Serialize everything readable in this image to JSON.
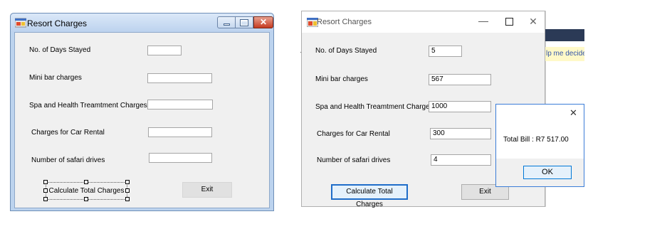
{
  "left_window": {
    "title": "Resort Charges",
    "labels": {
      "days": "No. of Days Stayed",
      "minibar": "Mini bar charges",
      "spa": "Spa and Health Treamtment Charges",
      "car": "Charges for Car Rental",
      "safari": "Number of safari drives"
    },
    "values": {
      "days": "",
      "minibar": "",
      "spa": "",
      "car": "",
      "safari": ""
    },
    "calc_label": "Calculate Total Charges",
    "exit_label": "Exit"
  },
  "right_window": {
    "title": "Resort Charges",
    "labels": {
      "days": "No. of Days Stayed",
      "minibar": "Mini bar charges",
      "spa": "Spa and Health Treamtment Charges",
      "car": "Charges for Car Rental",
      "safari": "Number of safari drives"
    },
    "values": {
      "days": "5",
      "minibar": "567",
      "spa": "1000",
      "car": "300",
      "safari": "4"
    },
    "calc_label": "Calculate Total Charges",
    "exit_label": "Exit"
  },
  "background_app": {
    "banner_text": "lp me decide"
  },
  "message_box": {
    "text": "Total Bill : R7 517.00",
    "ok_label": "OK"
  }
}
